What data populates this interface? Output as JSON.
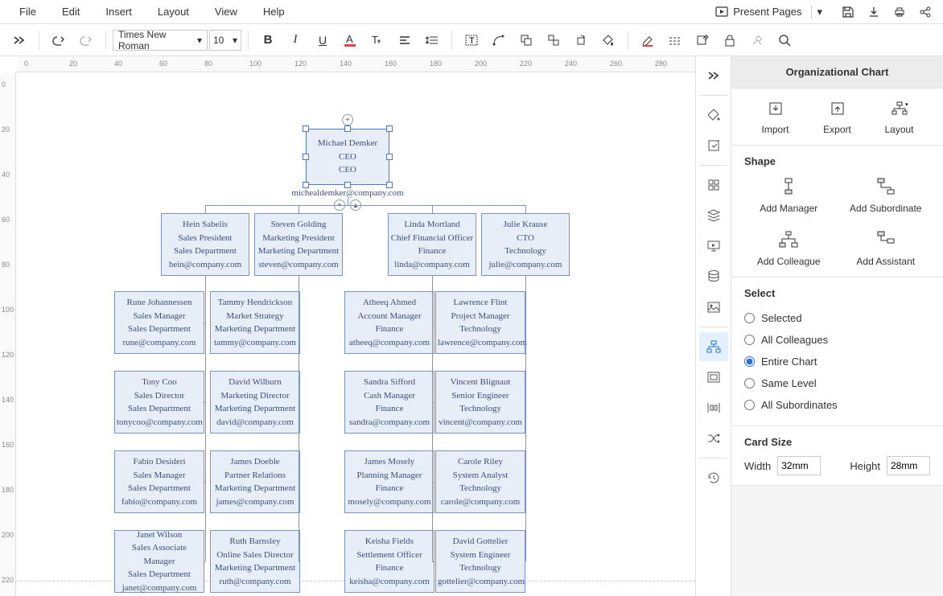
{
  "menubar": {
    "items": [
      "File",
      "Edit",
      "Insert",
      "Layout",
      "View",
      "Help"
    ],
    "present": "Present Pages"
  },
  "toolbar": {
    "font": "Times New Roman",
    "size": "10"
  },
  "rulerH": [
    0,
    20,
    40,
    60,
    80,
    100,
    120,
    140,
    160,
    180,
    200,
    220,
    240,
    260,
    280
  ],
  "rulerV": [
    0,
    20,
    40,
    60,
    80,
    100,
    120,
    140,
    160,
    180,
    200,
    220
  ],
  "panel": {
    "title": "Organizational Chart",
    "actions": [
      "Import",
      "Export",
      "Layout"
    ],
    "shape_header": "Shape",
    "shapes": [
      "Add Manager",
      "Add Subordinate",
      "Add Colleague",
      "Add Assistant"
    ],
    "select_header": "Select",
    "select_options": [
      "Selected",
      "All Colleagues",
      "Entire Chart",
      "Same Level",
      "All Subordinates"
    ],
    "select_value": "Entire Chart",
    "cardsize_header": "Card Size",
    "width_label": "Width",
    "width_value": "32mm",
    "height_label": "Height",
    "height_value": "28mm"
  },
  "org": {
    "root": {
      "name": "Michael Demker",
      "title": "CEO",
      "title2": "CEO",
      "email": "michealdemker@company.com"
    },
    "l2": [
      {
        "name": "Hein Sabelis",
        "title": "Sales President",
        "dept": "Sales Department",
        "email": "hein@company.com"
      },
      {
        "name": "Steven Golding",
        "title": "Marketing President",
        "dept": "Marketing Department",
        "email": "steven@company.com"
      },
      {
        "name": "Linda Mortland",
        "title": "Chief Financial Officer",
        "dept": "Finance",
        "email": "linda@company.com"
      },
      {
        "name": "Julie Krause",
        "title": "CTO",
        "dept": "Technology",
        "email": "julie@company.com"
      }
    ],
    "cols": [
      [
        {
          "name": "Rune Johannessen",
          "title": "Sales Manager",
          "dept": "Sales Department",
          "email": "rune@company.com"
        },
        {
          "name": "Tony Coo",
          "title": "Sales Director",
          "dept": "Sales Department",
          "email": "tonycoo@company.com"
        },
        {
          "name": "Fabio Desideri",
          "title": "Sales Manager",
          "dept": "Sales Department",
          "email": "fabio@company.com"
        },
        {
          "name": "Janet Wilson",
          "title": "Sales Associate Manager",
          "dept": "Sales Department",
          "email": "janet@company.com"
        }
      ],
      [
        {
          "name": "Tammy Hendrickson",
          "title": "Market Strategy",
          "dept": "Marketing Department",
          "email": "tammy@company.com"
        },
        {
          "name": "David Wilburn",
          "title": "Marketing Director",
          "dept": "Marketing Department",
          "email": "david@company.com"
        },
        {
          "name": "James Doeble",
          "title": "Partner Relations",
          "dept": "Marketing Department",
          "email": "james@company.com"
        },
        {
          "name": "Ruth Barnsley",
          "title": "Online Sales Director",
          "dept": "Marketing Department",
          "email": "ruth@company.com"
        }
      ],
      [
        {
          "name": "Atheeq Ahmed",
          "title": "Account Manager",
          "dept": "Finance",
          "email": "atheeq@company.com"
        },
        {
          "name": "Sandra Sifford",
          "title": "Cash Manager",
          "dept": "Finance",
          "email": "sandra@company.com"
        },
        {
          "name": "James Mosely",
          "title": "Planning Manager",
          "dept": "Finance",
          "email": "mosely@company.com"
        },
        {
          "name": "Keisha Fields",
          "title": "Settlement Officer",
          "dept": "Finance",
          "email": "keisha@company.com"
        }
      ],
      [
        {
          "name": "Lawrence Flint",
          "title": "Project Manager",
          "dept": "Technology",
          "email": "lawrence@company.com"
        },
        {
          "name": "Vincent Blignaut",
          "title": "Senior Engineer",
          "dept": "Technology",
          "email": "vincent@company.com"
        },
        {
          "name": "Carole Riley",
          "title": "System Analyst",
          "dept": "Technology",
          "email": "carole@company.com"
        },
        {
          "name": "David Gottelier",
          "title": "System Engineer",
          "dept": "Technology",
          "email": "gottelier@company.com"
        }
      ]
    ]
  }
}
